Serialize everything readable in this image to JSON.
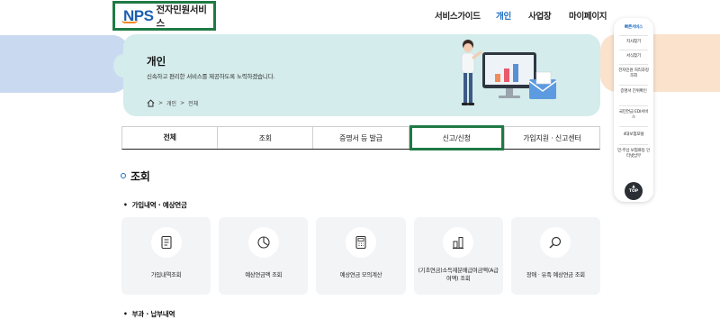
{
  "header": {
    "logo_mark": "NPS",
    "logo_text": "전자민원서비스",
    "nav": [
      {
        "label": "서비스가이드",
        "active": false
      },
      {
        "label": "개인",
        "active": true
      },
      {
        "label": "사업장",
        "active": false
      },
      {
        "label": "마이페이지",
        "active": false
      }
    ]
  },
  "banner": {
    "title": "개인",
    "description": "신속하고 편리한 서비스를 제공하도록 노력하겠습니다.",
    "breadcrumb": [
      "개인",
      "전체"
    ]
  },
  "quick_menu": {
    "items": [
      "빠른서비스",
      "지사찾기",
      "서식찾기",
      "전자민원 처리과정조회",
      "증명서 진위확인",
      "국민연금 EDI서비스",
      "4대보험포털",
      "민·주납 보험료등 인터넷납부"
    ],
    "top_label": "TOP"
  },
  "tabs": [
    {
      "label": "전체",
      "active": true
    },
    {
      "label": "조회",
      "active": false
    },
    {
      "label": "증명서 등 발급",
      "active": false
    },
    {
      "label": "신고/신청",
      "active": false
    },
    {
      "label": "가입지원 · 신고센터",
      "active": false
    }
  ],
  "section": {
    "title": "조회",
    "groups": [
      {
        "title": "가입내역 · 예상연금",
        "cards": [
          {
            "icon": "document-icon",
            "label": "가입내역조회"
          },
          {
            "icon": "pie-chart-icon",
            "label": "예상연금액 조회"
          },
          {
            "icon": "calculator-icon",
            "label": "예상연금 모의계산"
          },
          {
            "icon": "bar-chart-icon",
            "label": "(기초연금)소득재분배급여금액(A급여액) 조회"
          },
          {
            "icon": "magnifier-icon",
            "label": "장애 · 유족 예상연금 조회"
          }
        ]
      },
      {
        "title": "부과 · 납부내역",
        "cards": []
      }
    ]
  },
  "colors": {
    "brand_blue": "#1d6ec1",
    "highlight_green": "#1f7a45",
    "banner_bg": "#d4eceb",
    "logo_orange": "#f08a24"
  }
}
